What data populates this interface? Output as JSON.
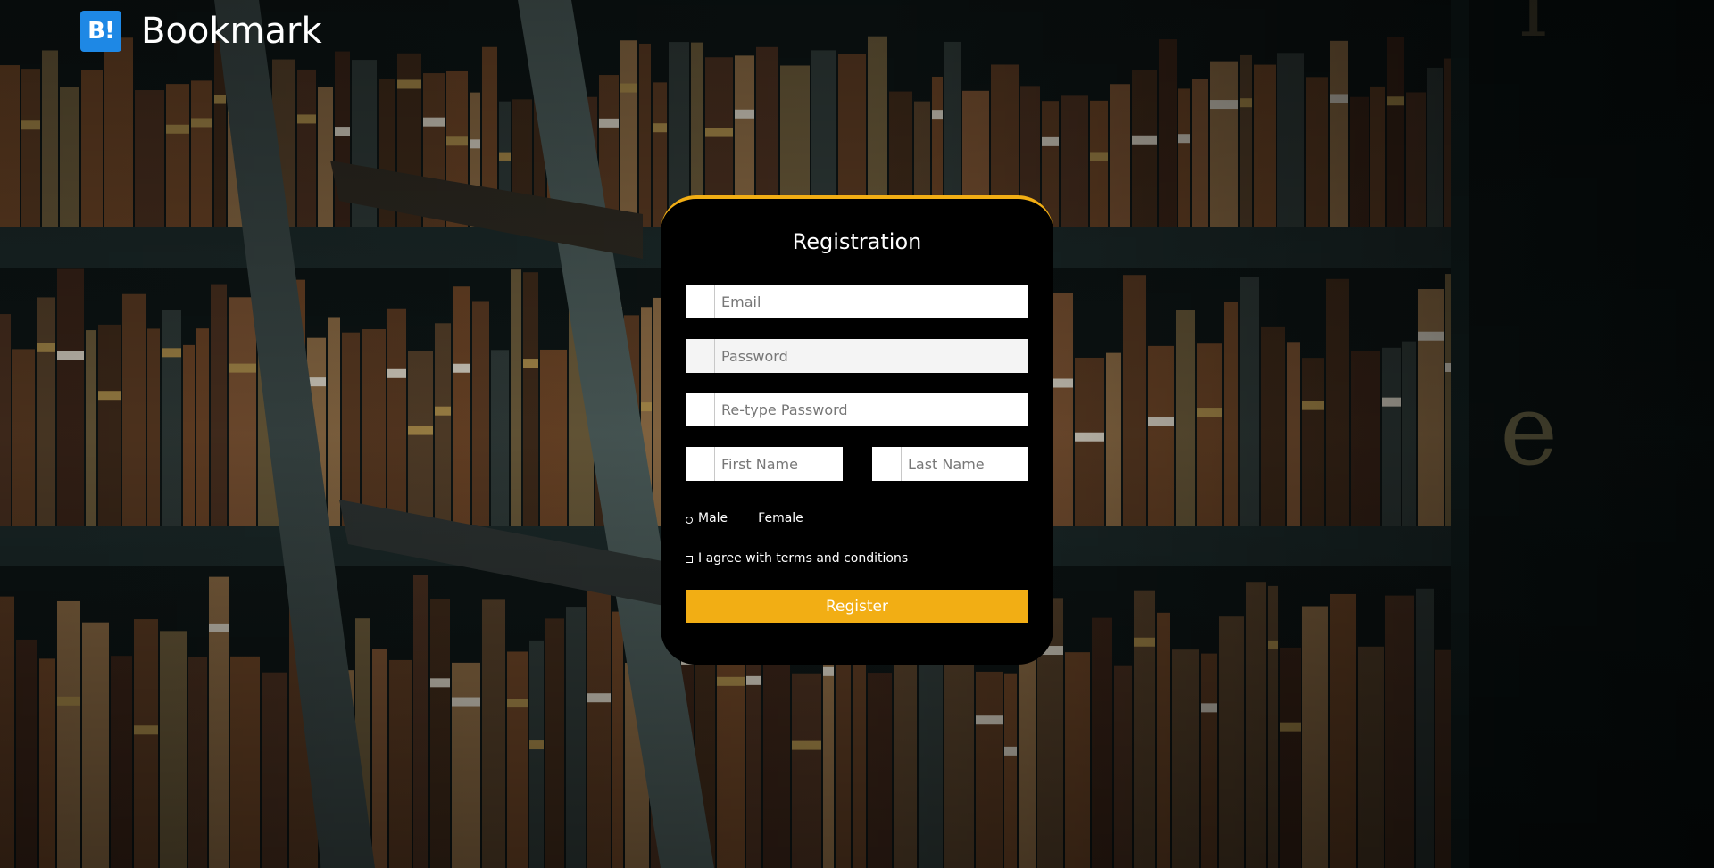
{
  "brand": {
    "logo_text": "B!",
    "name": "Bookmark",
    "logo_color": "#1e88e5"
  },
  "form": {
    "title": "Registration",
    "email_placeholder": "Email",
    "password_placeholder": "Password",
    "retype_password_placeholder": "Re-type Password",
    "first_name_placeholder": "First Name",
    "last_name_placeholder": "Last Name",
    "gender_options": [
      "Male",
      "Female"
    ],
    "terms_label": "I agree with terms and conditions",
    "register_label": "Register",
    "accent_color": "#f2ae14"
  },
  "background": {
    "description_icon": "library-bookshelf-image"
  }
}
